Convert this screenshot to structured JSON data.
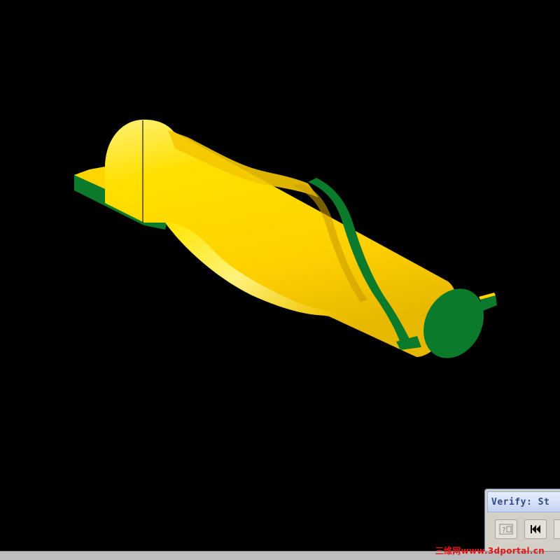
{
  "viewport": {
    "background": "#000000",
    "model": {
      "name": "end-mill-cutter",
      "body_color": "#ffd500",
      "body_shade": "#d9b200",
      "stock_color": "#0b7a2b"
    }
  },
  "verify_window": {
    "title": "Verify: St",
    "buttons": [
      {
        "name": "help-button",
        "icon": "help-query-icon"
      },
      {
        "name": "rewind-to-start-button",
        "icon": "skip-to-start-icon"
      },
      {
        "name": "next-button",
        "icon": "button-edge"
      }
    ]
  },
  "watermark": {
    "text": "三维网www.3dportal.cn",
    "color": "#e01818"
  }
}
